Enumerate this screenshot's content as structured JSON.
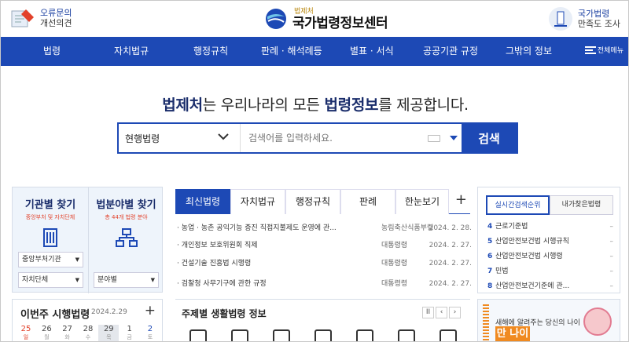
{
  "header": {
    "feedback_line1": "오류문의",
    "feedback_line2": "개선의견",
    "logo_sub": "법제처",
    "logo_main": "국가법령정보센터",
    "survey_line1": "국가법령",
    "survey_line2": "만족도 조사"
  },
  "nav": {
    "items": [
      "법령",
      "자치법규",
      "행정규칙",
      "판례 · 해석례등",
      "별표 · 서식",
      "공공기관 규정",
      "그밖의 정보"
    ],
    "all_menu": "전체메뉴"
  },
  "hero": {
    "part1": "법제처",
    "part2": "는 우리나라의 모든 ",
    "part3": "법령정보",
    "part4": "를 제공합니다."
  },
  "search": {
    "scope": "현행법령",
    "placeholder": "검색어를 입력하세요.",
    "button": "검색"
  },
  "finder": {
    "agency_title": "기관별 찾기",
    "agency_sub": "중앙부처 및 자치단체",
    "field_title": "법분야별 찾기",
    "field_sub": "총 44개 법령 분야",
    "dd_central": "중앙부처기관",
    "dd_local": "자치단체",
    "dd_field": "분야별"
  },
  "weekly": {
    "title": "이번주 시행법령",
    "date": "2024.2.29",
    "days": [
      {
        "num": "25",
        "wd": "일"
      },
      {
        "num": "26",
        "wd": "월"
      },
      {
        "num": "27",
        "wd": "화"
      },
      {
        "num": "28",
        "wd": "수"
      },
      {
        "num": "29",
        "wd": "목"
      },
      {
        "num": "1",
        "wd": "금"
      },
      {
        "num": "2",
        "wd": "토"
      }
    ]
  },
  "tabs": [
    "최신법령",
    "자치법규",
    "행정규칙",
    "판례",
    "한눈보기"
  ],
  "news": [
    {
      "title": "· 농업 · 농촌 공익기능 증진 직접지불제도 운영에 관...",
      "agency": "농림축산식품부령",
      "date": "2024. 2. 28."
    },
    {
      "title": "· 개인정보 보호위원회 직제",
      "agency": "대통령령",
      "date": "2024. 2. 27."
    },
    {
      "title": "· 건설기술 진흥법 시행령",
      "agency": "대통령령",
      "date": "2024. 2. 27."
    },
    {
      "title": "· 검찰청 사무기구에 관한 규정",
      "agency": "대통령령",
      "date": "2024. 2. 27."
    }
  ],
  "life": {
    "title": "주제별 생활법령 정보",
    "pause": "II",
    "prev": "‹",
    "next": "›"
  },
  "ranking": {
    "tab_realtime": "실시간검색순위",
    "tab_frequent": "내가찾은법령",
    "items": [
      {
        "n": "4",
        "t": "근로기준법"
      },
      {
        "n": "5",
        "t": "산업안전보건법 시행규칙"
      },
      {
        "n": "6",
        "t": "산업안전보건법 시행령"
      },
      {
        "n": "7",
        "t": "민법"
      },
      {
        "n": "8",
        "t": "산업안전보건기준에 관..."
      }
    ],
    "dash": "–"
  },
  "banner": {
    "line": "새해에 알려주는 당신의 나이",
    "big": "만 나이"
  },
  "colors": {
    "brand": "#1d49b5",
    "accent_red": "#e2412a",
    "orange": "#f08a20"
  }
}
